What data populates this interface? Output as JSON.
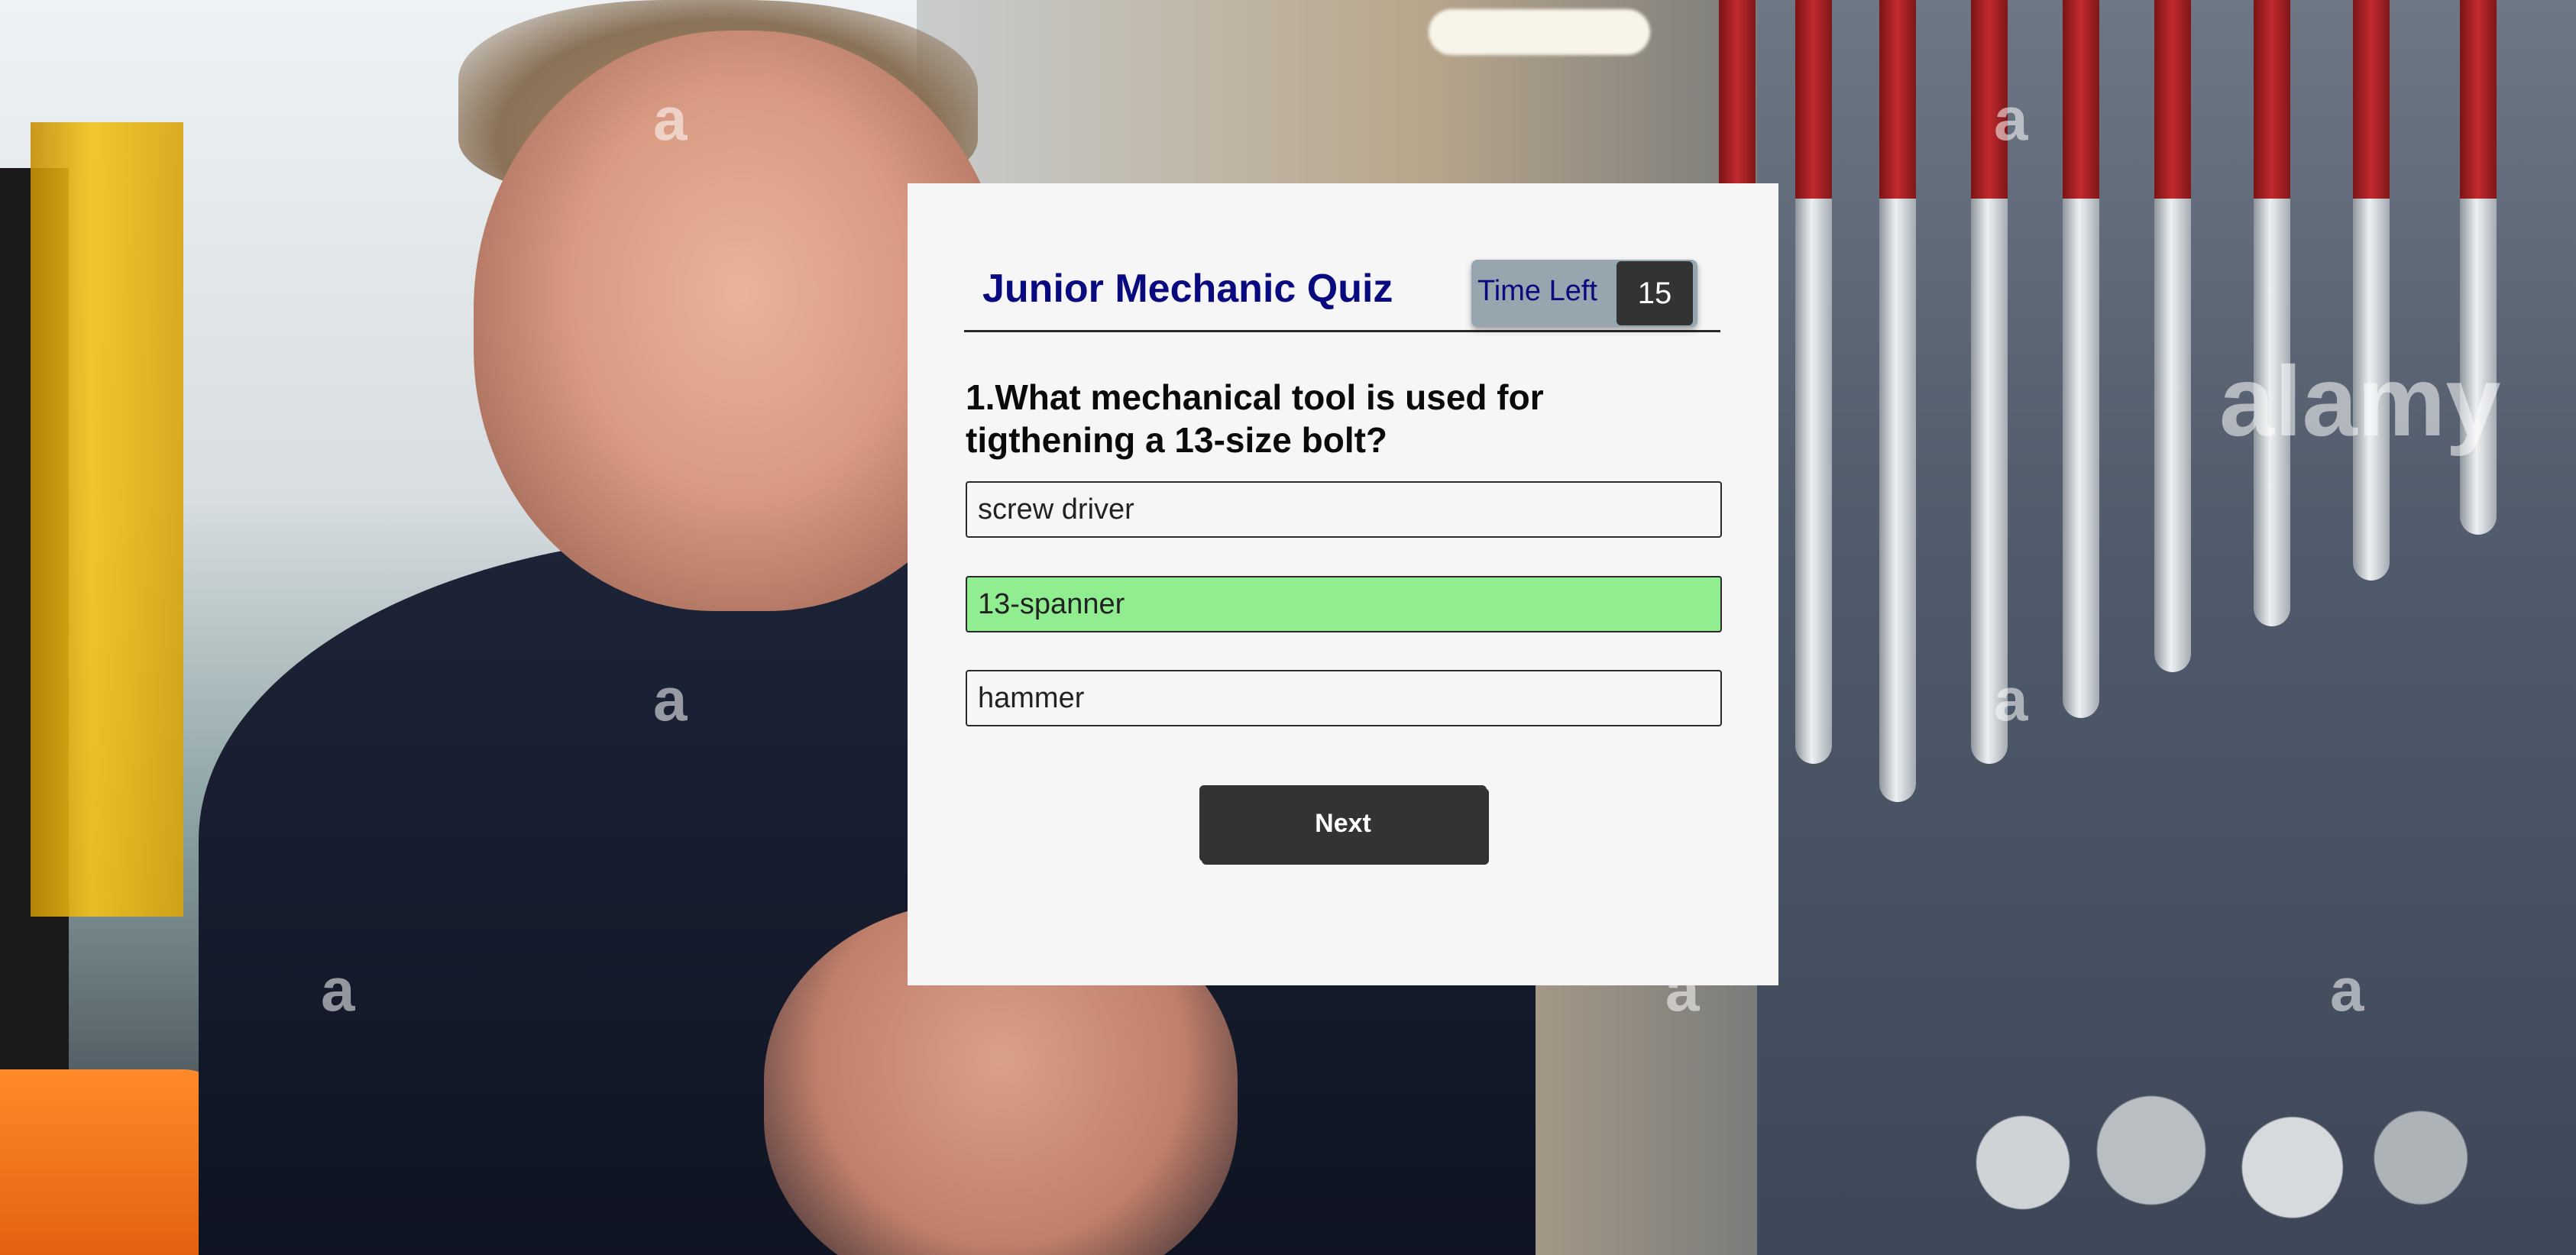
{
  "background": {
    "description_icon": "mechanic-photo-background",
    "watermark_mark": "a",
    "watermark_brand": "alamy"
  },
  "quiz": {
    "title": "Junior Mechanic Quiz",
    "timer": {
      "label": "Time Left",
      "value": "15"
    },
    "question": {
      "number": "1",
      "text": "1.What mechanical tool is used for tigthening a 13-size bolt?"
    },
    "options": [
      {
        "label": "screw driver",
        "state": "default"
      },
      {
        "label": "13-spanner",
        "state": "correct"
      },
      {
        "label": "hammer",
        "state": "default"
      }
    ],
    "next_label": "Next"
  },
  "colors": {
    "title": "#0a0a80",
    "card_bg": "#f6f6f6",
    "timer_bg": "#97a5ae",
    "timer_count_bg": "#333333",
    "correct_option": "#90ee90",
    "next_button_bg": "#333333"
  }
}
